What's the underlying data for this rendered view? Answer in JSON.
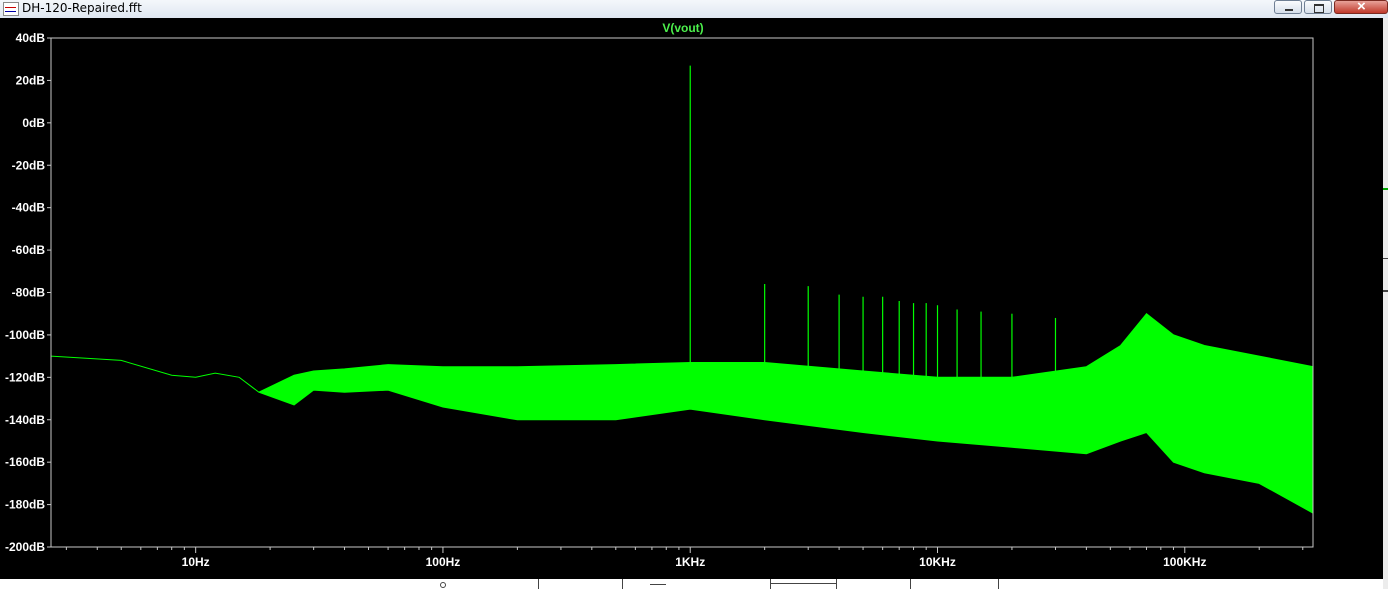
{
  "window": {
    "title": "DH-120-Repaired.fft",
    "buttons": [
      "minimize-button",
      "maximize-button",
      "close-button"
    ]
  },
  "colors": {
    "background": "#000000",
    "frame": "#c8c8c8",
    "trace": "#00ff00",
    "trace_label": "#4cf04c",
    "tick_text": "#ffffff"
  },
  "chart_data": {
    "type": "line",
    "title": "V(vout)",
    "xscale": "log",
    "xlim": [
      2.6,
      330000
    ],
    "ylim": [
      -200,
      40
    ],
    "yunit": "dB",
    "grid": false,
    "x_ticks": [
      {
        "value": 10,
        "label": "10Hz"
      },
      {
        "value": 100,
        "label": "100Hz"
      },
      {
        "value": 1000,
        "label": "1KHz"
      },
      {
        "value": 10000,
        "label": "10KHz"
      },
      {
        "value": 100000,
        "label": "100KHz"
      }
    ],
    "y_ticks": [
      {
        "value": 40,
        "label": "40dB"
      },
      {
        "value": 20,
        "label": "20dB"
      },
      {
        "value": 0,
        "label": "0dB"
      },
      {
        "value": -20,
        "label": "-20dB"
      },
      {
        "value": -40,
        "label": "-40dB"
      },
      {
        "value": -60,
        "label": "-60dB"
      },
      {
        "value": -80,
        "label": "-80dB"
      },
      {
        "value": -100,
        "label": "-100dB"
      },
      {
        "value": -120,
        "label": "-120dB"
      },
      {
        "value": -140,
        "label": "-140dB"
      },
      {
        "value": -160,
        "label": "-160dB"
      },
      {
        "value": -180,
        "label": "-180dB"
      },
      {
        "value": -200,
        "label": "-200dB"
      }
    ],
    "series": [
      {
        "name": "V(vout)",
        "noise_envelope": {
          "x": [
            2.6,
            5,
            8,
            10,
            12,
            15,
            18,
            25,
            30,
            40,
            60,
            100,
            200,
            500,
            1000,
            2000,
            5000,
            10000,
            20000,
            40000,
            55000,
            70000,
            90000,
            120000,
            200000,
            330000
          ],
          "y_upper": [
            -110,
            -112,
            -119,
            -120,
            -118,
            -120,
            -127,
            -119,
            -117,
            -116,
            -114,
            -115,
            -115,
            -114,
            -113,
            -113,
            -117,
            -120,
            -120,
            -115,
            -105,
            -90,
            -100,
            -105,
            -110,
            -115
          ],
          "y_lower": [
            -110,
            -112,
            -119,
            -120,
            -118,
            -120,
            -127,
            -133,
            -126,
            -127,
            -126,
            -134,
            -140,
            -140,
            -135,
            -140,
            -146,
            -150,
            -153,
            -156,
            -150,
            -146,
            -160,
            -165,
            -170,
            -184
          ]
        },
        "spikes": [
          {
            "x": 1000,
            "y": 27
          },
          {
            "x": 2000,
            "y": -76
          },
          {
            "x": 3000,
            "y": -77
          },
          {
            "x": 4000,
            "y": -81
          },
          {
            "x": 5000,
            "y": -82
          },
          {
            "x": 6000,
            "y": -82
          },
          {
            "x": 7000,
            "y": -84
          },
          {
            "x": 8000,
            "y": -85
          },
          {
            "x": 9000,
            "y": -85
          },
          {
            "x": 10000,
            "y": -86
          },
          {
            "x": 12000,
            "y": -88
          },
          {
            "x": 15000,
            "y": -89
          },
          {
            "x": 20000,
            "y": -90
          },
          {
            "x": 30000,
            "y": -92
          }
        ]
      }
    ]
  }
}
